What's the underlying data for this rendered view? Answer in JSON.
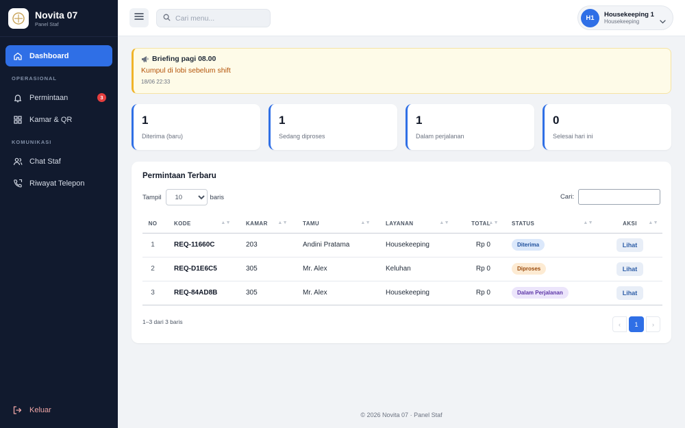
{
  "brand": {
    "name": "Novita 07",
    "subtitle": "Panel Staf"
  },
  "sidebar": {
    "dashboard": "Dashboard",
    "section_ops": "OPERASIONAL",
    "requests": "Permintaan",
    "requests_badge": "3",
    "rooms": "Kamar & QR",
    "section_comm": "KOMUNIKASI",
    "chat": "Chat Staf",
    "calls": "Riwayat Telepon",
    "logout": "Keluar"
  },
  "topbar": {
    "search_placeholder": "Cari menu...",
    "user_initials": "H1",
    "user_name": "Housekeeping 1",
    "user_role": "Housekeeping"
  },
  "alert": {
    "title": "Briefing pagi 08.00",
    "message": "Kumpul di lobi sebelum shift",
    "time": "18/06 22:33"
  },
  "stats": [
    {
      "value": "1",
      "label": "Diterima (baru)"
    },
    {
      "value": "1",
      "label": "Sedang diproses"
    },
    {
      "value": "1",
      "label": "Dalam perjalanan"
    },
    {
      "value": "0",
      "label": "Selesai hari ini"
    }
  ],
  "table": {
    "title": "Permintaan Terbaru",
    "show_label": "Tampil",
    "page_size": "10",
    "rows_label": "baris",
    "search_label": "Cari:",
    "columns": [
      "NO",
      "KODE",
      "KAMAR",
      "TAMU",
      "LAYANAN",
      "TOTAL",
      "STATUS",
      "AKSI"
    ],
    "rows": [
      {
        "no": "1",
        "code": "REQ-11660C",
        "room": "203",
        "guest": "Andini Pratama",
        "service": "Housekeeping",
        "total": "Rp 0",
        "status": "Diterima",
        "action": "Lihat"
      },
      {
        "no": "2",
        "code": "REQ-D1E6C5",
        "room": "305",
        "guest": "Mr. Alex",
        "service": "Keluhan",
        "total": "Rp 0",
        "status": "Diproses",
        "action": "Lihat"
      },
      {
        "no": "3",
        "code": "REQ-84AD8B",
        "room": "305",
        "guest": "Mr. Alex",
        "service": "Housekeeping",
        "total": "Rp 0",
        "status": "Dalam Perjalanan",
        "action": "Lihat"
      }
    ],
    "info": "1–3 dari 3 baris",
    "pager": {
      "prev": "‹",
      "current": "1",
      "next": "›"
    }
  },
  "status_colors": {
    "Diterima": {
      "bg": "#dbe8fb",
      "fg": "#1e4f9c"
    },
    "Diproses": {
      "bg": "#fdebd3",
      "fg": "#9a4a0c"
    },
    "Dalam Perjalanan": {
      "bg": "#ece5fb",
      "fg": "#5b34a6"
    }
  },
  "footer": "© 2026 Novita 07 · Panel Staf"
}
